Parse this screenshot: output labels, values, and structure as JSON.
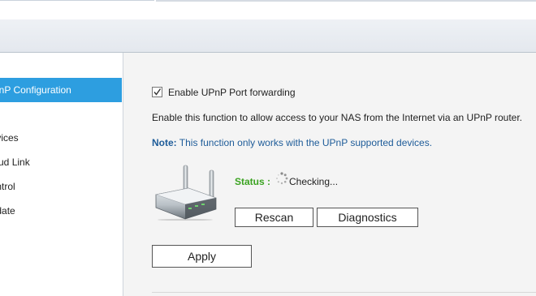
{
  "sidebar": {
    "items": [
      {
        "label": "UPnP Configuration",
        "active": true
      },
      {
        "label": "Devices"
      },
      {
        "label": "Cloud Link"
      },
      {
        "label": "Control"
      },
      {
        "label": "Update"
      }
    ]
  },
  "upnp": {
    "enable_label": "Enable UPnP Port forwarding",
    "enabled": true,
    "description": "Enable this function to allow access to your NAS from the Internet via an UPnP router.",
    "note_label": "Note:",
    "note_text": "This function only works with the UPnP supported devices.",
    "status_label": "Status :",
    "status_value": "Checking...",
    "rescan_label": "Rescan",
    "diagnostics_label": "Diagnostics",
    "apply_label": "Apply"
  },
  "colors": {
    "accent": "#2d9ee0",
    "note": "#1e5c99",
    "status": "#3ba321"
  },
  "icons": [
    "checkbox-checked-icon",
    "router-icon",
    "spinner-icon"
  ]
}
